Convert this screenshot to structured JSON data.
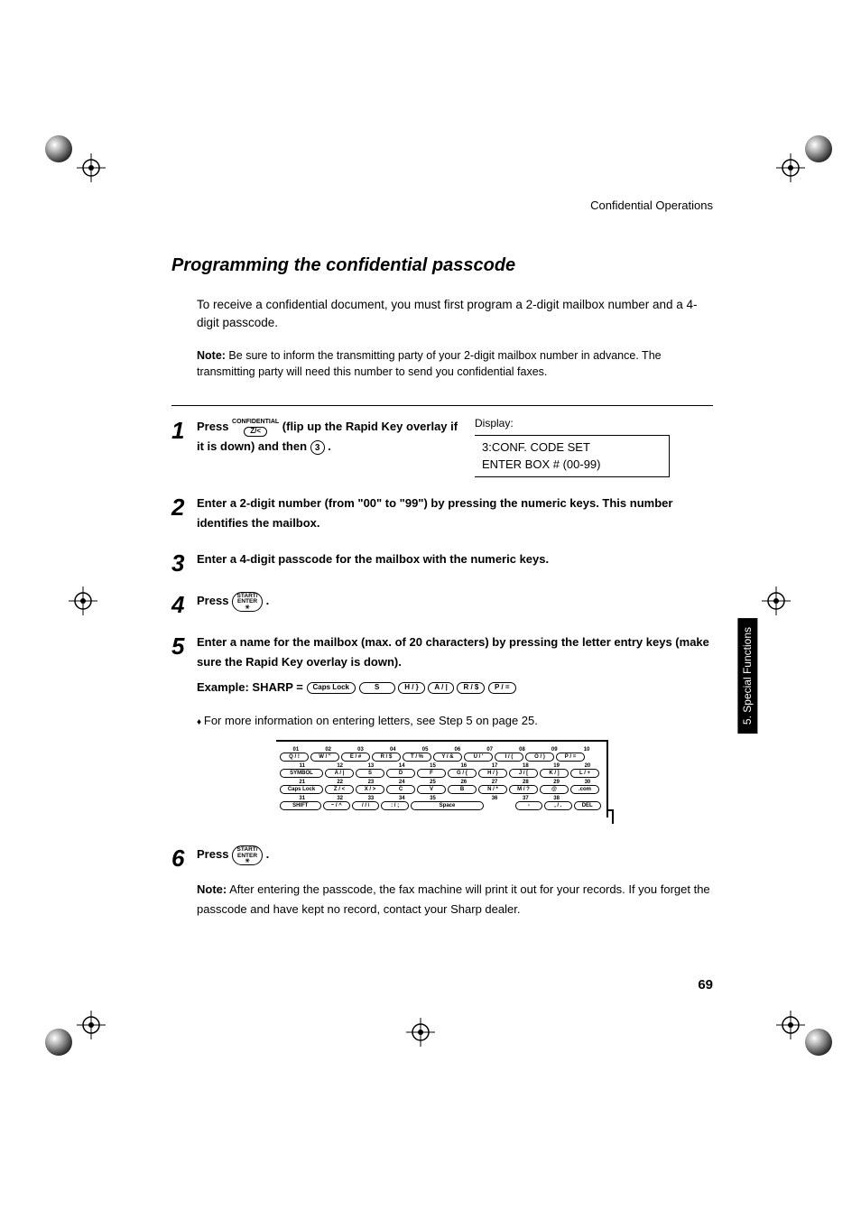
{
  "header": {
    "section": "Confidential Operations"
  },
  "heading": "Programming the confidential passcode",
  "intro": "To receive a confidential document, you must first program a 2-digit mailbox number and a 4-digit passcode.",
  "note_label": "Note:",
  "note_body": " Be sure to inform the transmitting party of your 2-digit mailbox number in advance. The transmitting party will need this number to send you confidential faxes.",
  "display": {
    "label": "Display:",
    "line1": "3:CONF. CODE SET",
    "line2": "ENTER BOX # (00-99)"
  },
  "keys": {
    "confidential_top": "CONFIDENTIAL",
    "confidential_sub": "Z/<",
    "three": "3",
    "start_l1": "START/",
    "start_l2": "ENTER",
    "start_sym": "✳",
    "caps": "Caps Lock",
    "s": "S",
    "h": "H / }",
    "a": "A / |",
    "r": "R / $",
    "p": "P / ="
  },
  "steps": {
    "s1": {
      "n": "1",
      "a": "Press  ",
      "b": "  (flip up the Rapid Key overlay if it is down) and then  ",
      "c": " ."
    },
    "s2": {
      "n": "2",
      "t": "Enter a 2-digit number (from \"00\" to \"99\") by pressing the numeric keys. This number identifies the mailbox."
    },
    "s3": {
      "n": "3",
      "t": "Enter a 4-digit passcode for the mailbox with the numeric keys."
    },
    "s4": {
      "n": "4",
      "a": "Press ",
      "b": " ."
    },
    "s5": {
      "n": "5",
      "a": "Enter a name for the mailbox (max. of 20 characters) by pressing the letter entry keys (make sure the Rapid Key overlay is down).",
      "ex": "Example: SHARP =  "
    },
    "s6": {
      "n": "6",
      "a": "Press ",
      "b": "."
    }
  },
  "bullet": "For more information on entering letters, see Step 5 on page 25.",
  "note2_label": "Note:",
  "note2_body": " After entering the passcode, the fax machine will print it out for your records. If you forget the passcode and have kept no record, contact your Sharp dealer.",
  "kb": {
    "nums1": [
      "01",
      "02",
      "03",
      "04",
      "05",
      "06",
      "07",
      "08",
      "09",
      "10"
    ],
    "row1": [
      "Q / !",
      "W / \"",
      "E / #",
      "R / $",
      "T / %",
      "Y / &",
      "U / '",
      "I / (",
      "O / )",
      "P / ="
    ],
    "nums2": [
      "11",
      "12",
      "13",
      "14",
      "15",
      "16",
      "17",
      "18",
      "19",
      "20"
    ],
    "row2_lead": "SYMBOL",
    "row2": [
      "A / |",
      "S",
      "D",
      "F",
      "G / {",
      "H / }",
      "J / [",
      "K / ]",
      "L / +"
    ],
    "nums3": [
      "21",
      "22",
      "23",
      "24",
      "25",
      "26",
      "27",
      "28",
      "29",
      "30"
    ],
    "row3_lead": "Caps Lock",
    "row3": [
      "Z / <",
      "X / >",
      "C",
      "V",
      "B",
      "N / *",
      "M / ?",
      "@",
      ".com"
    ],
    "nums4": [
      "31",
      "32",
      "33",
      "34",
      "35",
      "",
      "36",
      "37",
      "38",
      ""
    ],
    "row4_lead": "SHIFT",
    "row4": [
      "~ / ^",
      "/ / \\",
      ": / ;",
      "Space",
      "",
      "-",
      ", / .",
      "DEL"
    ]
  },
  "page_number": "69",
  "side_tab": "5. Special\nFunctions"
}
